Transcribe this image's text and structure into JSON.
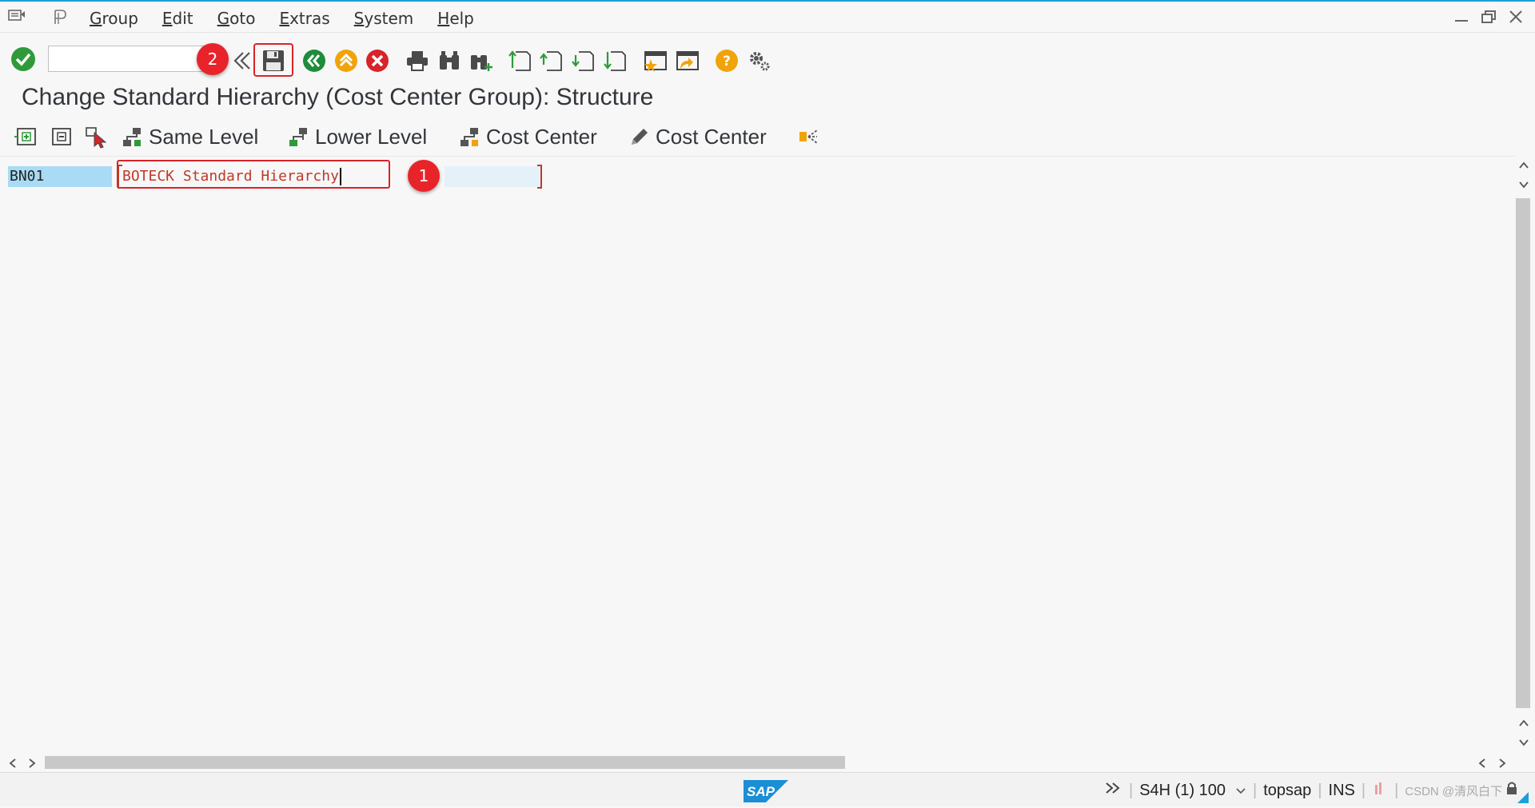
{
  "menu": {
    "items": [
      "Group",
      "Edit",
      "Goto",
      "Extras",
      "System",
      "Help"
    ]
  },
  "toolbar": {
    "command_field_value": "",
    "badge_save": "2"
  },
  "page": {
    "title": "Change Standard Hierarchy (Cost Center Group): Structure"
  },
  "app_toolbar": {
    "same_level": "Same Level",
    "lower_level": "Lower Level",
    "cost_center_create": "Cost Center",
    "cost_center_change": "Cost Center"
  },
  "hierarchy": {
    "node_id": "BN01",
    "node_text": "BOTECK Standard Hierarchy",
    "badge_text": "1"
  },
  "status": {
    "system": "S4H (1) 100",
    "user": "topsap",
    "mode": "INS",
    "watermark": "CSDN @清风白下"
  },
  "colors": {
    "accent_blue": "#1a9fd9",
    "highlight_red": "#d9232b",
    "node_bg": "#a9dcf4"
  }
}
